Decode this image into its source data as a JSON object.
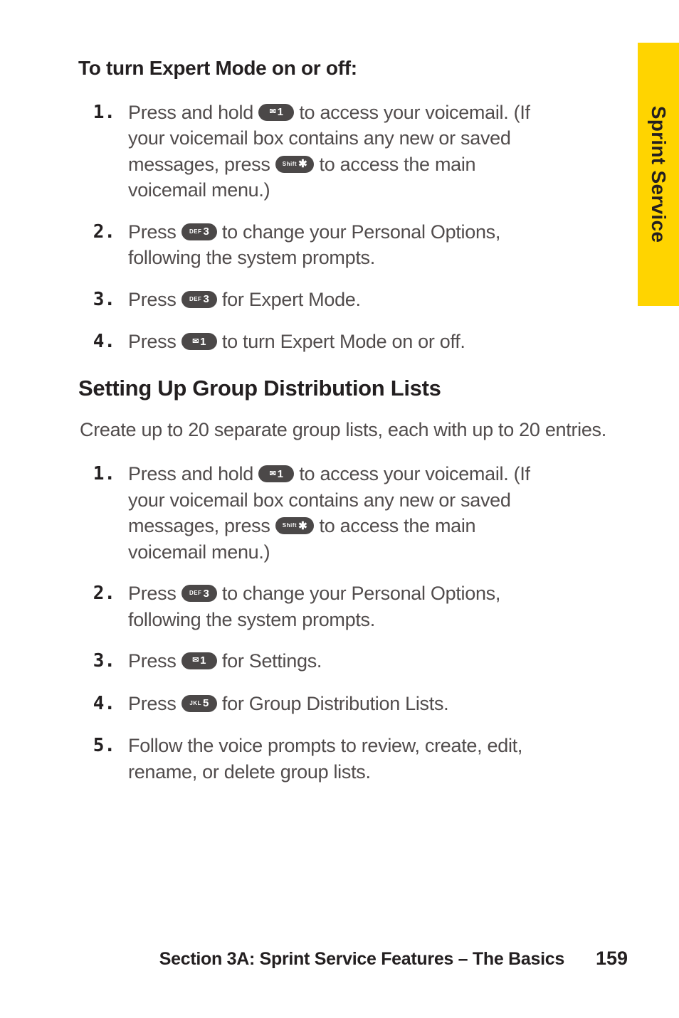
{
  "side_tab": {
    "label": "Sprint Service"
  },
  "section1": {
    "heading": "To turn Expert Mode on or off:",
    "steps": [
      {
        "num": "1.",
        "pre1": "Press and hold ",
        "key1": {
          "tiny": "",
          "big": "1",
          "mail": true
        },
        "mid1": " to access your voicemail. (If your voicemail box contains any new or saved messages, press ",
        "key2": {
          "tiny": "Shift",
          "big": "✱",
          "mail": false
        },
        "post": " to access the main voicemail menu.)"
      },
      {
        "num": "2.",
        "pre1": "Press ",
        "key1": {
          "tiny": "DEF",
          "big": "3",
          "mail": false
        },
        "post": " to change your Personal Options, following the system prompts."
      },
      {
        "num": "3.",
        "pre1": "Press ",
        "key1": {
          "tiny": "DEF",
          "big": "3",
          "mail": false
        },
        "post": " for Expert Mode."
      },
      {
        "num": "4.",
        "pre1": "Press ",
        "key1": {
          "tiny": "",
          "big": "1",
          "mail": true
        },
        "post": " to turn Expert Mode on or off."
      }
    ]
  },
  "section2": {
    "heading": "Setting Up Group Distribution Lists",
    "intro": "Create up to 20 separate group lists, each with up to 20 entries.",
    "steps": [
      {
        "num": "1.",
        "pre1": "Press and hold ",
        "key1": {
          "tiny": "",
          "big": "1",
          "mail": true
        },
        "mid1": " to access your voicemail. (If your voicemail box contains any new or saved messages, press ",
        "key2": {
          "tiny": "Shift",
          "big": "✱",
          "mail": false
        },
        "post": " to access the main voicemail menu.)"
      },
      {
        "num": "2.",
        "pre1": "Press ",
        "key1": {
          "tiny": "DEF",
          "big": "3",
          "mail": false
        },
        "post": " to change your Personal Options, following the system prompts."
      },
      {
        "num": "3.",
        "pre1": "Press ",
        "key1": {
          "tiny": "",
          "big": "1",
          "mail": true
        },
        "post": " for Settings."
      },
      {
        "num": "4.",
        "pre1": "Press ",
        "key1": {
          "tiny": "JKL",
          "big": "5",
          "mail": false
        },
        "post": " for Group Distribution Lists."
      },
      {
        "num": "5.",
        "text": "Follow the voice prompts to review, create, edit, rename, or delete group lists."
      }
    ]
  },
  "footer": {
    "text": "Section 3A: Sprint Service Features – The Basics",
    "page": "159"
  }
}
